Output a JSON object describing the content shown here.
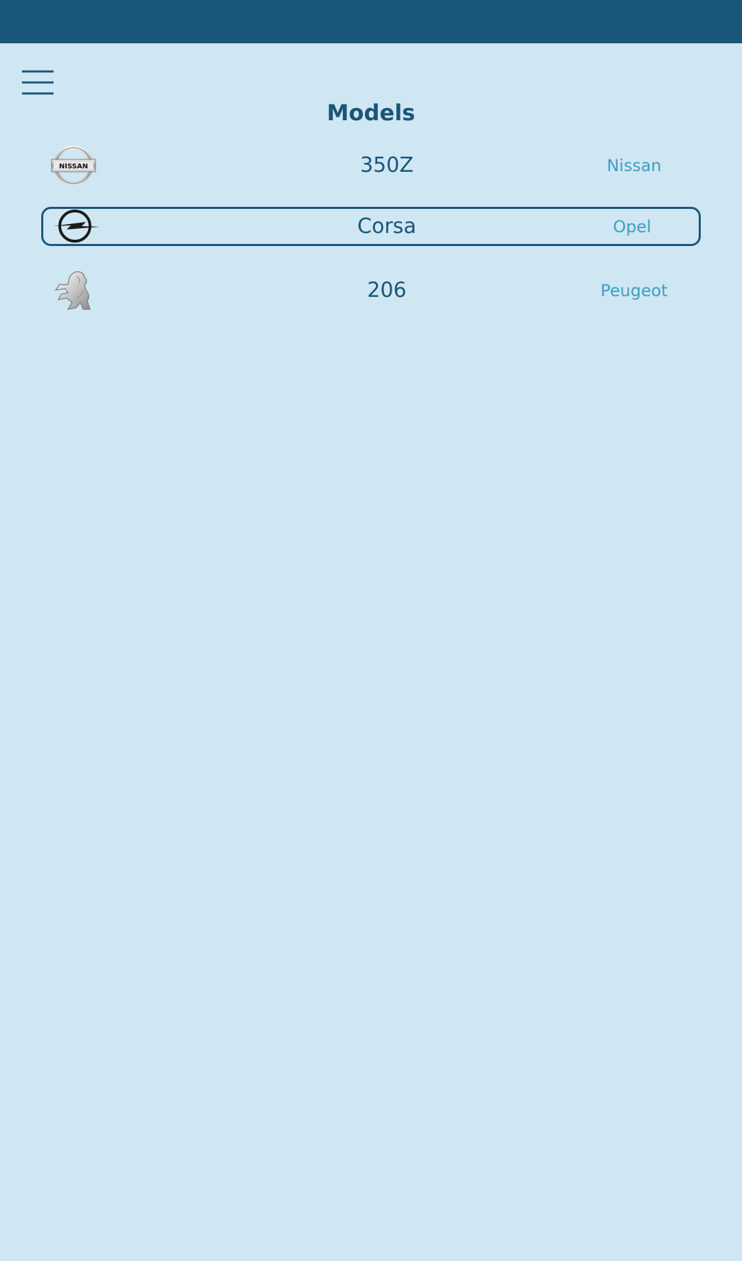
{
  "header": {
    "title": "Models",
    "menu_icon": "hamburger-menu-icon"
  },
  "models": [
    {
      "model": "350Z",
      "make": "Nissan",
      "logo_icon": "nissan-logo-icon",
      "selected": false
    },
    {
      "model": "Corsa",
      "make": "Opel",
      "logo_icon": "opel-logo-icon",
      "selected": true
    },
    {
      "model": "206",
      "make": "Peugeot",
      "logo_icon": "peugeot-logo-icon",
      "selected": false
    }
  ],
  "colors": {
    "status_bar": "#1a5678",
    "background": "#cfe6f3",
    "primary_text": "#1a5678",
    "secondary_text": "#3e9fc2",
    "selection_border": "#1a5678"
  }
}
